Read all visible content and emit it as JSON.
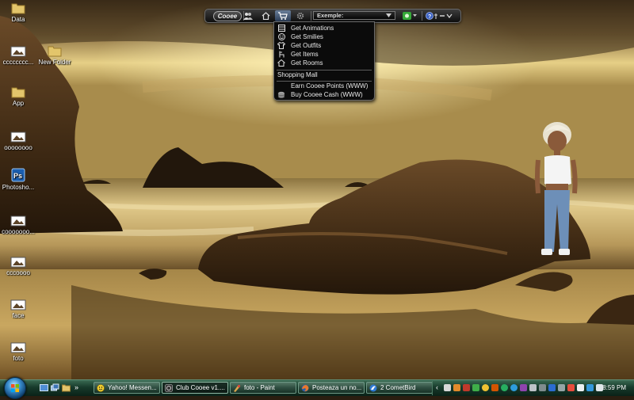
{
  "desktop": {
    "icons": [
      {
        "label": "Data",
        "kind": "folder"
      },
      {
        "label": "cccccccc...",
        "kind": "image"
      },
      {
        "label": "New Folder",
        "kind": "folder"
      },
      {
        "label": "App",
        "kind": "folder"
      },
      {
        "label": "oooooooo",
        "kind": "image"
      },
      {
        "label": "Photosho...",
        "kind": "photoshop"
      },
      {
        "label": "cooooooo...",
        "kind": "image"
      },
      {
        "label": "cccoooo",
        "kind": "image"
      },
      {
        "label": "face",
        "kind": "image"
      },
      {
        "label": "foto",
        "kind": "image"
      }
    ]
  },
  "cooee_toolbar": {
    "logo": "Cooee",
    "combo_value": "Exemple:",
    "icons": [
      "friends-icon",
      "home-icon",
      "cart-icon",
      "gear-icon",
      "status-icon",
      "help-icon"
    ]
  },
  "shop_menu": {
    "items": [
      {
        "label": "Get Animations",
        "icon": "animations-icon"
      },
      {
        "label": "Get Smilies",
        "icon": "smiley-icon"
      },
      {
        "label": "Get Outfits",
        "icon": "shirt-icon"
      },
      {
        "label": "Get Items",
        "icon": "chair-icon"
      },
      {
        "label": "Get Rooms",
        "icon": "house-icon"
      }
    ],
    "mall": {
      "label": "Shopping Mall"
    },
    "links": [
      {
        "label": "Earn Cooee Points (WWW)",
        "icon": ""
      },
      {
        "label": "Buy Cooee Cash (WWW)",
        "icon": "coins-icon"
      }
    ]
  },
  "taskbar": {
    "tasks": [
      {
        "label": "Yahoo! Messen...",
        "icon": "yahoo-icon",
        "active": false
      },
      {
        "label": "Club Cooee v1....",
        "icon": "cooee-icon",
        "active": true
      },
      {
        "label": "foto - Paint",
        "icon": "paint-icon",
        "active": false
      },
      {
        "label": "Posteaza un no...",
        "icon": "firefox-icon",
        "active": false
      },
      {
        "label": "2 CometBird",
        "icon": "cometbird-icon",
        "active": false
      }
    ],
    "clock": "8:59 PM"
  },
  "colors": {
    "menu_bg": "#0b0b0b",
    "menu_text": "#e8e8e8",
    "taskbar": "#173a2b",
    "toolbar_active": "#3f5575"
  }
}
